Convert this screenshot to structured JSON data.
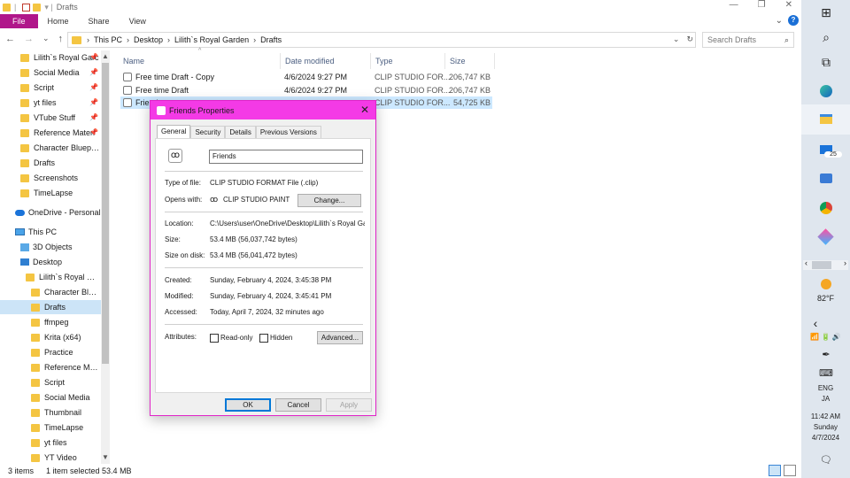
{
  "window": {
    "title": "Drafts",
    "minimize_glyph": "—",
    "restore_glyph": "❐",
    "close_glyph": "✕"
  },
  "ribbon": {
    "tabs": [
      "File",
      "Home",
      "Share",
      "View"
    ],
    "expand_glyph": "⌄",
    "help_glyph": "?"
  },
  "nav_buttons": {
    "back": "←",
    "forward": "→",
    "recent": "⌄",
    "up": "↑"
  },
  "address": {
    "crumbs": [
      "This PC",
      "Desktop",
      "Lilith`s Royal Garden",
      "Drafts"
    ],
    "chevron": "›",
    "dropdown_glyph": "⌄",
    "refresh_glyph": "↻"
  },
  "search": {
    "placeholder": "Search Drafts",
    "icon_glyph": "⌕"
  },
  "navpane": {
    "pin_glyph": "📌",
    "quick_access": [
      {
        "label": "Lilith`s Royal Garc",
        "pinned": true
      },
      {
        "label": "Social Media",
        "pinned": true
      },
      {
        "label": "Script",
        "pinned": true
      },
      {
        "label": "yt files",
        "pinned": true
      },
      {
        "label": "VTube Stuff",
        "pinned": true
      },
      {
        "label": "Reference Materi",
        "pinned": true
      },
      {
        "label": "Character Blueprint",
        "pinned": false
      },
      {
        "label": "Drafts",
        "pinned": false
      },
      {
        "label": "Screenshots",
        "pinned": false
      },
      {
        "label": "TimeLapse",
        "pinned": false
      }
    ],
    "onedrive": "OneDrive - Personal",
    "this_pc": "This PC",
    "objects3d": "3D Objects",
    "desktop": "Desktop",
    "royal_garden": "Lilith`s Royal Garde",
    "subfolders": [
      "Character Bluepri",
      "Drafts",
      "ffmpeg",
      "Krita (x64)",
      "Practice",
      "Reference Materi",
      "Script",
      "Social Media",
      "Thumbnail",
      "TimeLapse",
      "yt files",
      "YT Video"
    ],
    "scroll_up": "▲",
    "scroll_down": "▼"
  },
  "filelist": {
    "columns": {
      "name": "Name",
      "date": "Date modified",
      "type": "Type",
      "size": "Size"
    },
    "sort_glyph": "^",
    "rows": [
      {
        "name": "Free time Draft - Copy",
        "date": "4/6/2024 9:27 PM",
        "type": "CLIP STUDIO FOR...",
        "size": "206,747 KB"
      },
      {
        "name": "Free time Draft",
        "date": "4/6/2024 9:27 PM",
        "type": "CLIP STUDIO FOR...",
        "size": "206,747 KB"
      },
      {
        "name": "Friends",
        "date": "",
        "type": "CLIP STUDIO FOR...",
        "size": "54,725 KB"
      }
    ]
  },
  "status": {
    "items": "3 items",
    "selected": "1 item selected  53.4 MB"
  },
  "dialog": {
    "title": "Friends Properties",
    "close_glyph": "✕",
    "tabs": [
      "General",
      "Security",
      "Details",
      "Previous Versions"
    ],
    "filename": "Friends",
    "file_icon_glyph": "ꝏ",
    "app_icon_glyph": "ꝏ",
    "type_label": "Type of file:",
    "type_value": "CLIP STUDIO FORMAT File (.clip)",
    "opens_label": "Opens with:",
    "opens_value": "CLIP STUDIO PAINT",
    "change_btn": "Change...",
    "location_label": "Location:",
    "location_value": "C:\\Users\\user\\OneDrive\\Desktop\\Lilith`s Royal Gar",
    "size_label": "Size:",
    "size_value": "53.4 MB (56,037,742 bytes)",
    "disk_label": "Size on disk:",
    "disk_value": "53.4 MB (56,041,472 bytes)",
    "created_label": "Created:",
    "created_value": "Sunday, February 4, 2024, 3:45:38 PM",
    "modified_label": "Modified:",
    "modified_value": "Sunday, February 4, 2024, 3:45:41 PM",
    "accessed_label": "Accessed:",
    "accessed_value": "Today, April 7, 2024, 32 minutes ago",
    "attributes_label": "Attributes:",
    "readonly": "Read-only",
    "hidden": "Hidden",
    "advanced_btn": "Advanced...",
    "ok_btn": "OK",
    "cancel_btn": "Cancel",
    "apply_btn": "Apply"
  },
  "taskbar": {
    "start_glyph": "⊞",
    "search_glyph": "⌕",
    "taskview_glyph": "⧉",
    "mail_badge": "25",
    "weather_temp": "82°F",
    "tray_chevron": "‹",
    "tray_scroll_left": "‹",
    "tray_scroll_right": "›",
    "lang1": "ENG",
    "lang2": "JA",
    "time": "11:42 AM",
    "day": "Sunday",
    "date": "4/7/2024",
    "notif_glyph": "🗨"
  }
}
